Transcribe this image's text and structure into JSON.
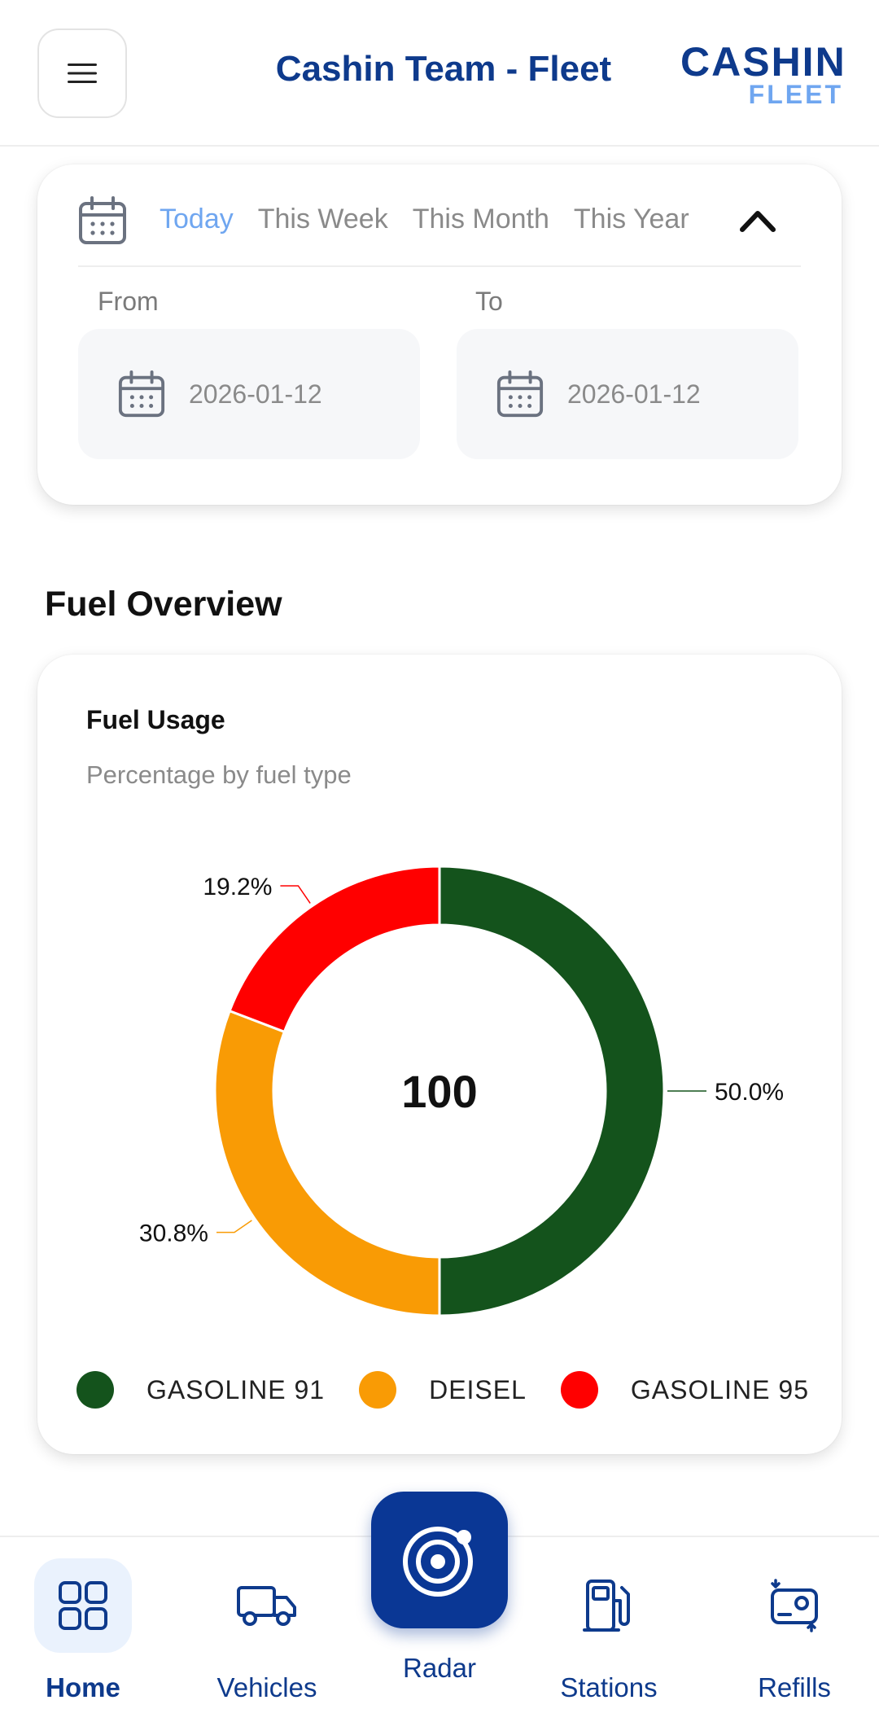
{
  "header": {
    "title": "Cashin Team - Fleet",
    "logo_top": "CASHIN",
    "logo_bottom": "FLEET",
    "menu_icon": "hamburger-icon"
  },
  "date_filter": {
    "ranges": [
      "Today",
      "This Week",
      "This Month",
      "This Year"
    ],
    "active_range": "Today",
    "from_label": "From",
    "to_label": "To",
    "from_value": "2026-01-12",
    "to_value": "2026-01-12",
    "collapse_icon": "chevron-up-icon"
  },
  "section_title": "Fuel Overview",
  "fuel_card": {
    "title": "Fuel Usage",
    "subtitle": "Percentage by fuel type"
  },
  "chart_data": {
    "type": "pie",
    "title": "Fuel Usage",
    "subtitle": "Percentage by fuel type",
    "center_label": "100",
    "categories": [
      "GASOLINE 91",
      "DEISEL",
      "GASOLINE 95"
    ],
    "values": [
      50.0,
      30.8,
      19.2
    ],
    "labels": [
      "50.0%",
      "30.8%",
      "19.2%"
    ],
    "colors": [
      "#14531c",
      "#f99b05",
      "#ff0000"
    ],
    "legend": "bottom"
  },
  "nav": {
    "items": [
      {
        "label": "Home",
        "icon": "grid-icon",
        "active": true
      },
      {
        "label": "Vehicles",
        "icon": "truck-icon",
        "active": false
      },
      {
        "label": "Radar",
        "icon": "radar-icon",
        "active": false
      },
      {
        "label": "Stations",
        "icon": "fuel-pump-icon",
        "active": false
      },
      {
        "label": "Refills",
        "icon": "refill-icon",
        "active": false
      }
    ]
  },
  "colors": {
    "brand": "#0e3a8c",
    "accent": "#6fa6f0",
    "radar_button": "#0a3795"
  }
}
